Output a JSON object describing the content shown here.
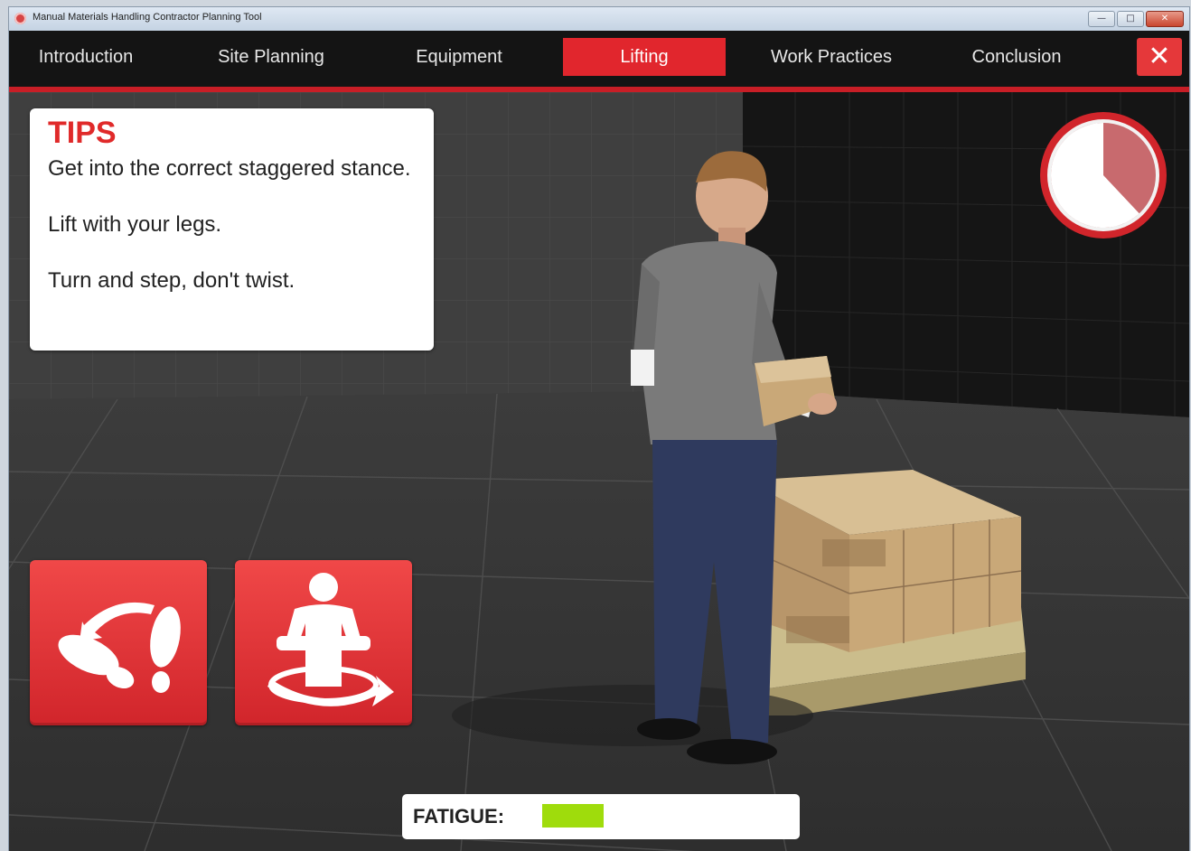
{
  "window": {
    "title": "Manual Materials Handling Contractor Planning Tool",
    "controls": [
      "minimize",
      "maximize",
      "close"
    ]
  },
  "nav": {
    "tabs": [
      {
        "label": "Introduction",
        "active": false
      },
      {
        "label": "Site Planning",
        "active": false
      },
      {
        "label": "Equipment",
        "active": false
      },
      {
        "label": "Lifting",
        "active": true
      },
      {
        "label": "Work Practices",
        "active": false
      },
      {
        "label": "Conclusion",
        "active": false
      }
    ],
    "close_label": "✕"
  },
  "tips": {
    "title": "TIPS",
    "lines": [
      "Get into the correct staggered stance.",
      "Lift with your legs.",
      "Turn and step, don't twist."
    ]
  },
  "timer": {
    "elapsed_fraction": 0.38
  },
  "actions": {
    "buttons": [
      {
        "icon": "turn-and-step-icon"
      },
      {
        "icon": "twist-torso-icon"
      }
    ]
  },
  "fatigue": {
    "label": "FATIGUE:",
    "level_fraction": 0.25
  },
  "colors": {
    "accent": "#e1262d",
    "fatigue_fill": "#9fdc0c",
    "nav_bg": "#141414"
  }
}
